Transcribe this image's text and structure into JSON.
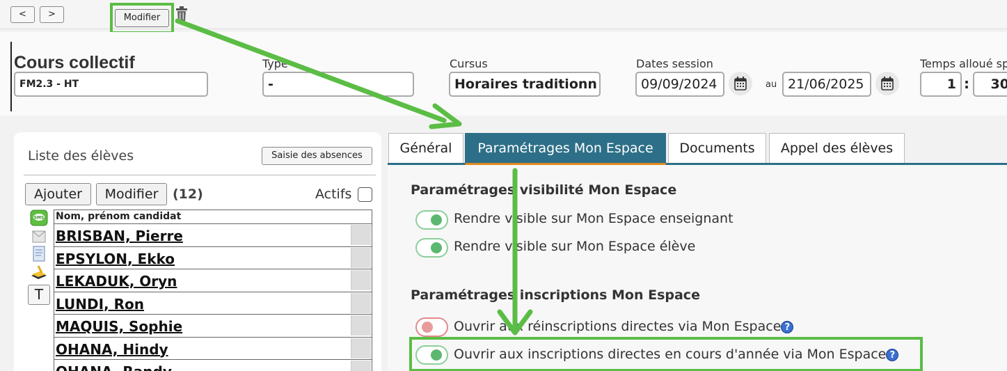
{
  "toolbar": {
    "prev_label": "<",
    "next_label": ">",
    "modify_label": "Modifier"
  },
  "course": {
    "title": "Cours collectif",
    "name_value": "FM2.3 - HT",
    "type_label": "Type",
    "type_value": "-",
    "cursus_label": "Cursus",
    "cursus_value": "Horaires traditionn",
    "dates_label": "Dates session",
    "date_start": "09/09/2024",
    "date_sep": "au",
    "date_end": "21/06/2025",
    "time_label": "Temps alloué sp",
    "time_hours": "1",
    "time_sep": ":",
    "time_minutes": "30"
  },
  "students_panel": {
    "title": "Liste des élèves",
    "absences_label": "Saisie des absences",
    "add_label": "Ajouter",
    "edit_label": "Modifier",
    "count": "(12)",
    "active_label": "Actifs",
    "column_header": "Nom, prénom candidat",
    "rows": [
      "BRISBAN, Pierre",
      "EPSYLON, Ekko",
      "LEKADUK, Oryn",
      "LUNDI, Ron",
      "MAQUIS, Sophie",
      "OHANA, Hindy",
      "OHANA, Randy"
    ],
    "side_icons": [
      "sms-icon",
      "envelope-icon",
      "document-icon",
      "book-icon",
      "text-icon"
    ],
    "text_icon_label": "T"
  },
  "tabs": [
    "Général",
    "Paramétrages Mon Espace",
    "Documents",
    "Appel des élèves"
  ],
  "settings": {
    "visibility_title": "Paramétrages visibilité Mon Espace",
    "visible_teacher": "Rendre visible sur Mon Espace enseignant",
    "visible_student": "Rendre visible sur Mon Espace élève",
    "registration_title": "Paramétrages inscriptions Mon Espace",
    "reregistration": "Ouvrir aux réinscriptions directes via Mon Espace",
    "registration_year": "Ouvrir aux inscriptions directes en cours d'année via Mon Espace",
    "help_glyph": "?"
  },
  "colors": {
    "highlight": "#5bbd45",
    "active_tab": "#2d6f88",
    "toggle_on": "#5cb870",
    "toggle_off": "#e89b9b"
  }
}
